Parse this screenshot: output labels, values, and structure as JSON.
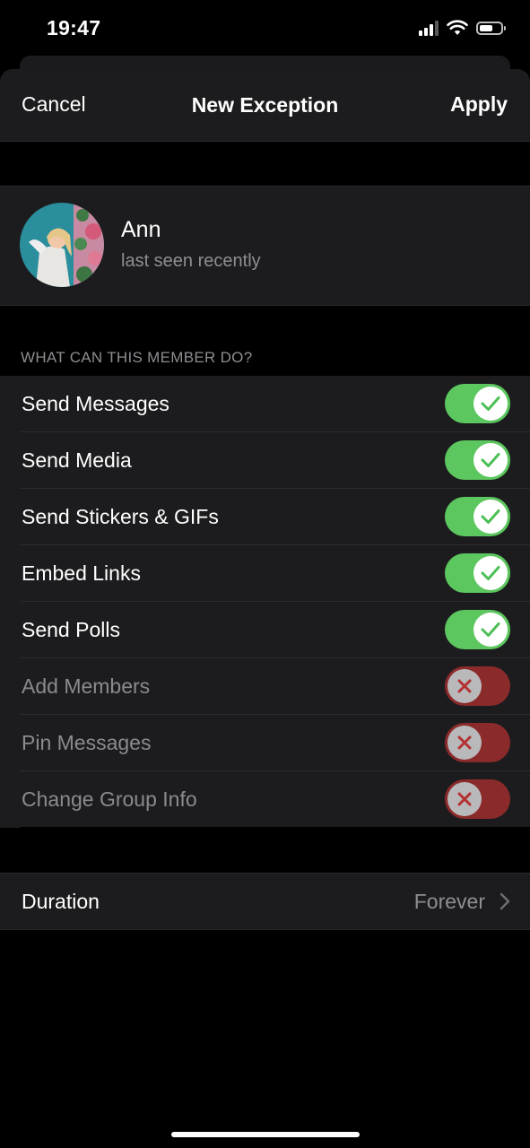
{
  "status_bar": {
    "time": "19:47"
  },
  "nav": {
    "cancel": "Cancel",
    "title": "New Exception",
    "apply": "Apply"
  },
  "user": {
    "name": "Ann",
    "status": "last seen recently"
  },
  "section_header": "WHAT CAN THIS MEMBER DO?",
  "permissions": [
    {
      "label": "Send Messages",
      "enabled": true
    },
    {
      "label": "Send Media",
      "enabled": true
    },
    {
      "label": "Send Stickers & GIFs",
      "enabled": true
    },
    {
      "label": "Embed Links",
      "enabled": true
    },
    {
      "label": "Send Polls",
      "enabled": true
    },
    {
      "label": "Add Members",
      "enabled": false
    },
    {
      "label": "Pin Messages",
      "enabled": false
    },
    {
      "label": "Change Group Info",
      "enabled": false
    }
  ],
  "duration": {
    "label": "Duration",
    "value": "Forever"
  },
  "colors": {
    "toggle_on": "#5cc75f",
    "toggle_off": "#8b2a2a",
    "check": "#4cbf55",
    "cross": "#b43232"
  }
}
